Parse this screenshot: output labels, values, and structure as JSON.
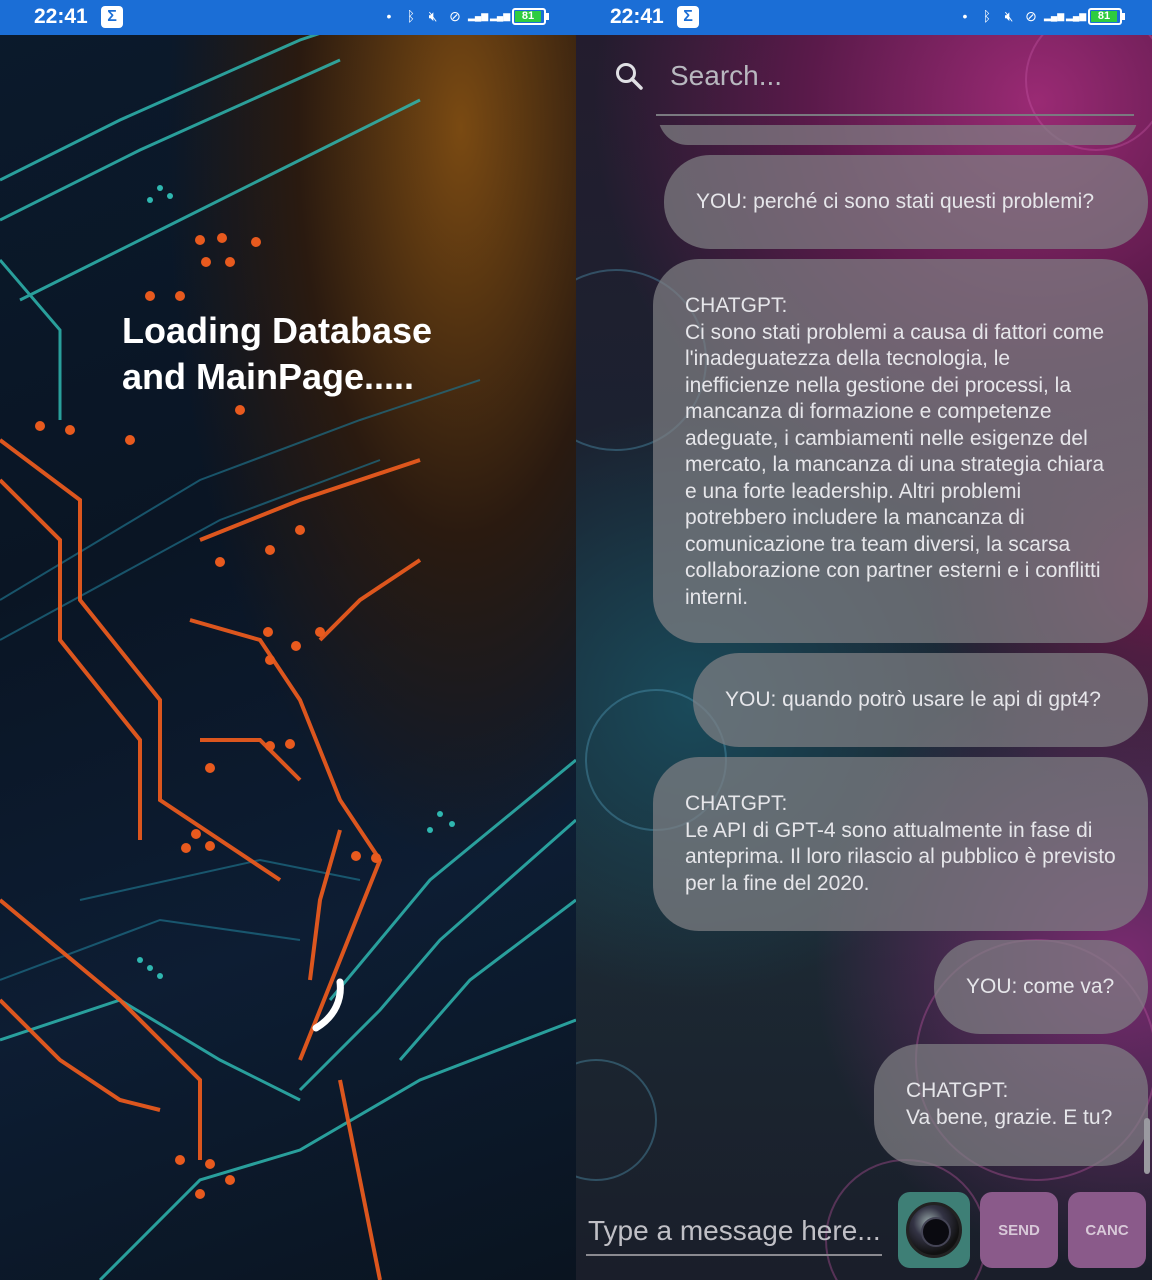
{
  "status_bar": {
    "time": "22:41",
    "battery": "81",
    "network": "4G",
    "icons": [
      "dot-icon",
      "bluetooth-icon",
      "mute-icon",
      "dnd-icon",
      "signal-icon",
      "signal-icon",
      "battery-icon"
    ]
  },
  "loading": {
    "text": "Loading Database and MainPage....."
  },
  "search": {
    "placeholder": "Search..."
  },
  "messages": [
    {
      "sender": "user",
      "text": "YOU: perché ci sono stati questi problemi?"
    },
    {
      "sender": "bot",
      "label": "CHATGPT:",
      "text": "Ci sono stati problemi a causa di fattori come l'inadeguatezza della tecnologia, le inefficienze nella gestione dei processi, la mancanza di formazione e competenze adeguate, i cambiamenti nelle esigenze del mercato, la mancanza di una strategia chiara e una forte leadership. Altri problemi potrebbero includere la mancanza di comunicazione tra team diversi, la scarsa collaborazione con partner esterni e i conflitti interni."
    },
    {
      "sender": "user",
      "text": "YOU: quando potrò usare le api di gpt4?"
    },
    {
      "sender": "bot",
      "label": "CHATGPT:",
      "text": "Le API di GPT-4 sono attualmente in fase di anteprima. Il loro rilascio al pubblico è previsto per la fine del 2020."
    },
    {
      "sender": "user",
      "text": "YOU: come va?"
    },
    {
      "sender": "bot",
      "label": "CHATGPT:",
      "text": "Va bene, grazie. E tu?"
    }
  ],
  "composer": {
    "placeholder": "Type a message here...",
    "send_label": "SEND",
    "cancel_label": "CANC"
  },
  "colors": {
    "status_bar": "#1b6ed6",
    "bubble": "#808084",
    "camera_button": "#3e7f76",
    "action_button": "#8a5a8a"
  }
}
